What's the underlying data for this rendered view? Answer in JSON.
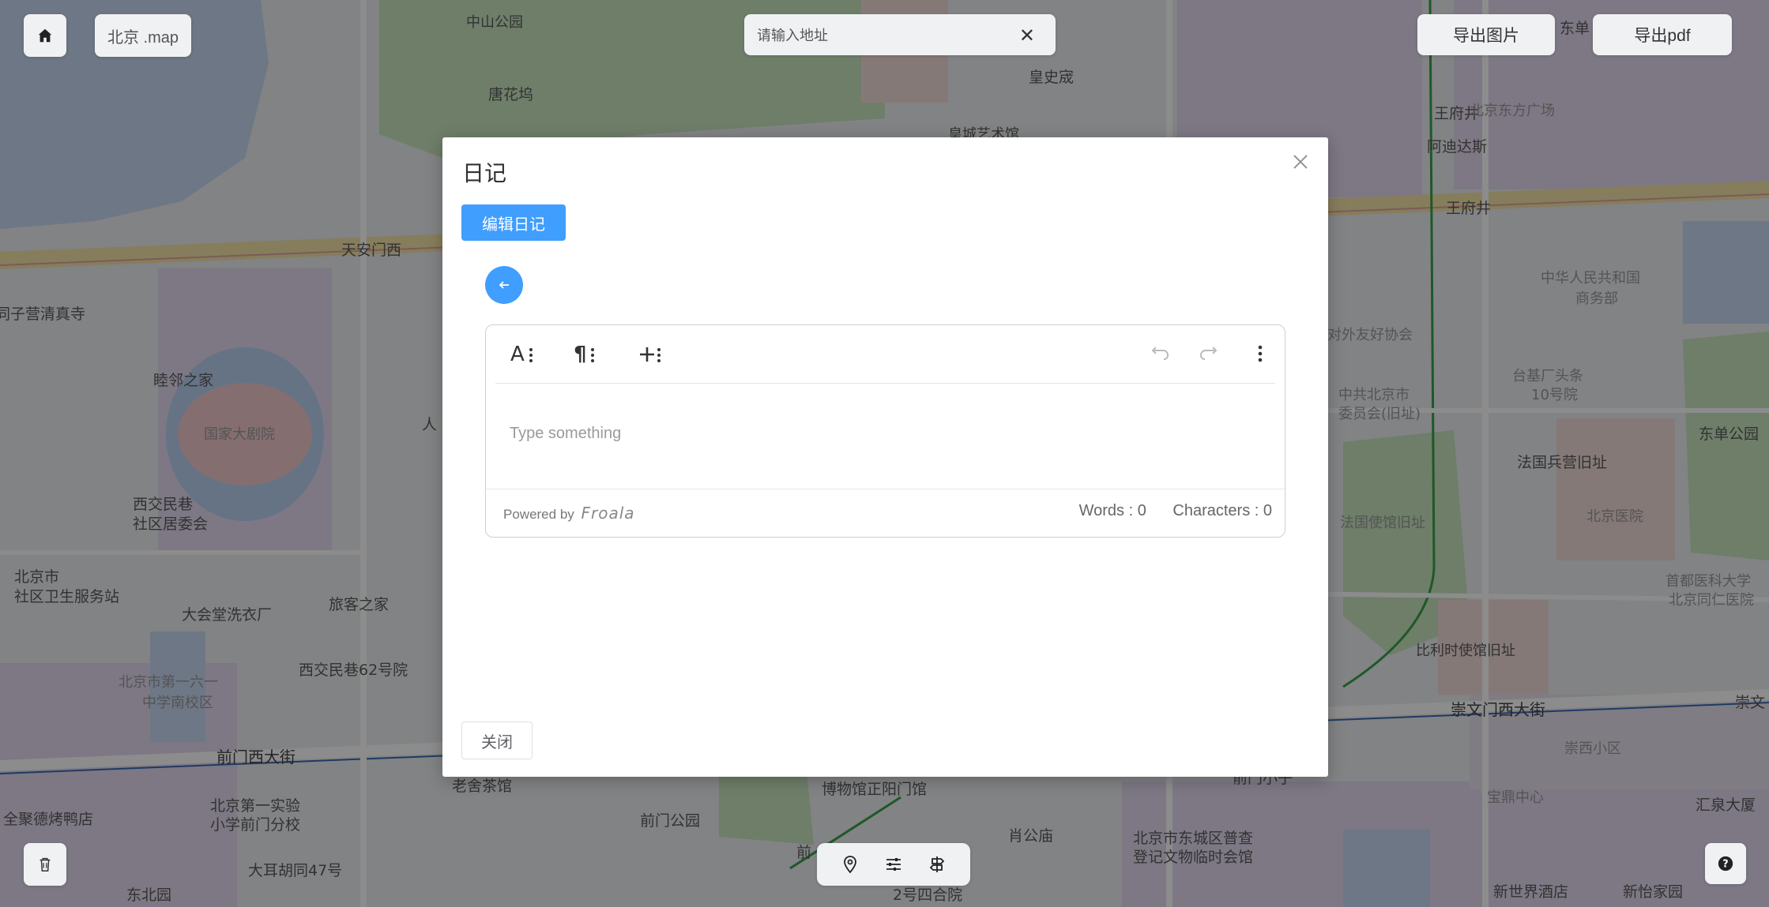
{
  "topbar": {
    "map_name": "北京 .map",
    "search_placeholder": "请输入地址",
    "export_image": "导出图片",
    "export_pdf": "导出pdf"
  },
  "map": {
    "labels": [
      "中山公园",
      "唐花坞",
      "皇史宬",
      "皇城艺术馆",
      "王府井",
      "阿迪达斯",
      "北京东方广场",
      "东单",
      "天安门西",
      "同子营清真寺",
      "睦邻之家",
      "国家大剧院",
      "西交民巷社区居委会",
      "北京市社区卫生服务站",
      "大会堂洗衣厂",
      "旅客之家",
      "西交民巷62号院",
      "北京市第一六一中学南校区",
      "前门西大街",
      "老舍茶馆",
      "北京第一实验小学前门分校",
      "全聚德烤鸭店",
      "前门公园",
      "大耳胡同47号",
      "东北园",
      "肖公庙",
      "2号四合院",
      "北京市东城区普查登记文物临时会馆",
      "新世界酒店",
      "新怡家园",
      "汇泉大厦",
      "崇文门西大街",
      "崇西小区",
      "宝鼎中心",
      "比利时使馆旧址",
      "法国使馆旧址",
      "北京医院",
      "法国兵营旧址",
      "东单公园",
      "首都医科大学北京同仁医院",
      "中华人民共和国商务部",
      "对外友好协会",
      "台基厂头条10号院",
      "中共北京市委员会(旧址)",
      "王府井",
      "前门",
      "博物馆正阳门馆",
      "人",
      "北京市第一六一",
      "崇文"
    ]
  },
  "dialog": {
    "title": "日记",
    "close_icon": "close-icon",
    "edit_label": "编辑日记",
    "editor": {
      "placeholder": "Type something",
      "powered_by": "Powered by",
      "brand": "Froala",
      "words": "Words : 0",
      "characters": "Characters : 0"
    },
    "close_label": "关闭"
  },
  "colors": {
    "accent": "#409eff",
    "water": "#c9d9f2",
    "park": "#c8e6c0",
    "district_purple": "#e3dbf0",
    "district_pink": "#f3dcda",
    "overlay": "rgba(0,0,0,0.45)"
  }
}
